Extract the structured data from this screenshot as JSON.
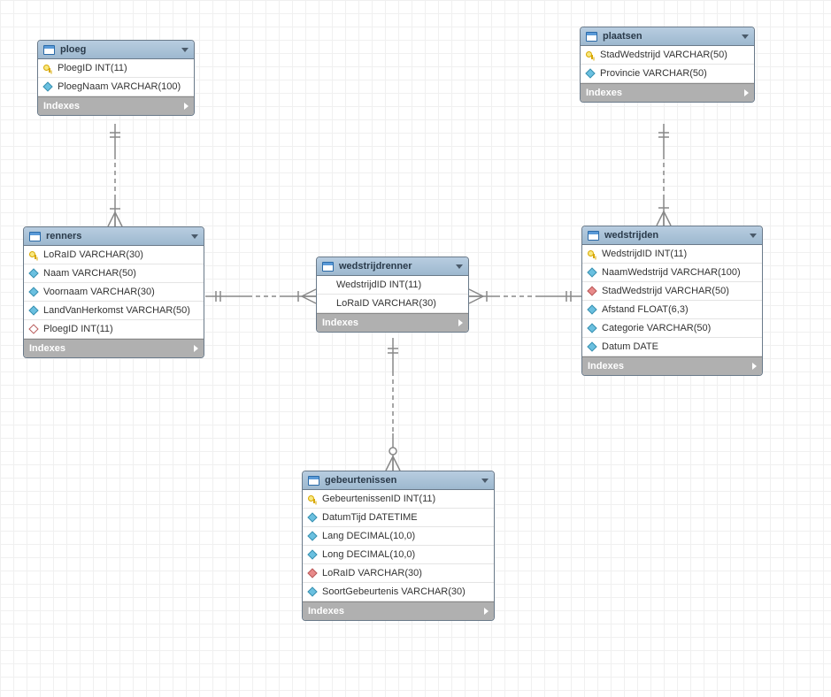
{
  "indexes_label": "Indexes",
  "entities": {
    "ploeg": {
      "name": "ploeg",
      "columns": [
        {
          "icon": "pk",
          "label": "PloegID INT(11)"
        },
        {
          "icon": "blue",
          "label": "PloegNaam VARCHAR(100)"
        }
      ]
    },
    "plaatsen": {
      "name": "plaatsen",
      "columns": [
        {
          "icon": "pk",
          "label": "StadWedstrijd VARCHAR(50)"
        },
        {
          "icon": "blue",
          "label": "Provincie VARCHAR(50)"
        }
      ]
    },
    "renners": {
      "name": "renners",
      "columns": [
        {
          "icon": "pk",
          "label": "LoRaID VARCHAR(30)"
        },
        {
          "icon": "blue",
          "label": "Naam VARCHAR(50)"
        },
        {
          "icon": "blue",
          "label": "Voornaam VARCHAR(30)"
        },
        {
          "icon": "blue",
          "label": "LandVanHerkomst VARCHAR(50)"
        },
        {
          "icon": "open",
          "label": "PloegID INT(11)"
        }
      ]
    },
    "wedstrijdrenner": {
      "name": "wedstrijdrenner",
      "columns": [
        {
          "icon": "none",
          "label": "WedstrijdID INT(11)"
        },
        {
          "icon": "none",
          "label": "LoRaID VARCHAR(30)"
        }
      ]
    },
    "wedstrijden": {
      "name": "wedstrijden",
      "columns": [
        {
          "icon": "pk",
          "label": "WedstrijdID INT(11)"
        },
        {
          "icon": "blue",
          "label": "NaamWedstrijd VARCHAR(100)"
        },
        {
          "icon": "red",
          "label": "StadWedstrijd VARCHAR(50)"
        },
        {
          "icon": "blue",
          "label": "Afstand FLOAT(6,3)"
        },
        {
          "icon": "blue",
          "label": "Categorie VARCHAR(50)"
        },
        {
          "icon": "blue",
          "label": "Datum DATE"
        }
      ]
    },
    "gebeurtenissen": {
      "name": "gebeurtenissen",
      "columns": [
        {
          "icon": "pk",
          "label": "GebeurtenissenID INT(11)"
        },
        {
          "icon": "blue",
          "label": "DatumTijd DATETIME"
        },
        {
          "icon": "blue",
          "label": "Lang DECIMAL(10,0)"
        },
        {
          "icon": "blue",
          "label": "Long DECIMAL(10,0)"
        },
        {
          "icon": "red",
          "label": "LoRaID VARCHAR(30)"
        },
        {
          "icon": "blue",
          "label": "SoortGebeurtenis VARCHAR(30)"
        }
      ]
    }
  },
  "relationships": [
    {
      "from": "ploeg",
      "to": "renners",
      "cardinality": "one-to-many"
    },
    {
      "from": "plaatsen",
      "to": "wedstrijden",
      "cardinality": "one-to-many"
    },
    {
      "from": "renners",
      "to": "wedstrijdrenner",
      "cardinality": "one-to-many"
    },
    {
      "from": "wedstrijden",
      "to": "wedstrijdrenner",
      "cardinality": "one-to-many"
    },
    {
      "from": "wedstrijdrenner",
      "to": "gebeurtenissen",
      "cardinality": "one-to-many"
    }
  ]
}
